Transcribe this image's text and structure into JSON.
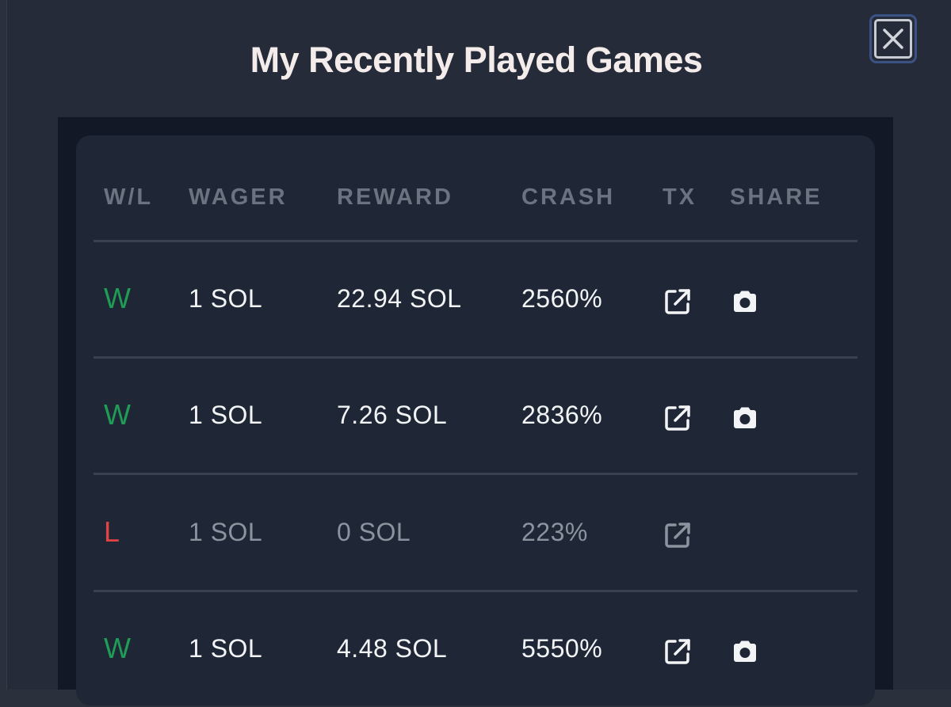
{
  "modal": {
    "title": "My Recently Played Games",
    "close_label": "Close"
  },
  "table": {
    "headers": {
      "wl": "W/L",
      "wager": "WAGER",
      "reward": "REWARD",
      "crash": "CRASH",
      "tx": "TX",
      "share": "SHARE"
    },
    "rows": [
      {
        "result": "W",
        "wager": "1 SOL",
        "reward": "22.94 SOL",
        "crash": "2560%",
        "tx_icon": "external-link-icon",
        "share_icon": "camera-icon"
      },
      {
        "result": "W",
        "wager": "1 SOL",
        "reward": "7.26 SOL",
        "crash": "2836%",
        "tx_icon": "external-link-icon",
        "share_icon": "camera-icon"
      },
      {
        "result": "L",
        "wager": "1 SOL",
        "reward": "0 SOL",
        "crash": "223%",
        "tx_icon": "external-link-icon",
        "share_icon": ""
      },
      {
        "result": "W",
        "wager": "1 SOL",
        "reward": "4.48 SOL",
        "crash": "5550%",
        "tx_icon": "external-link-icon",
        "share_icon": "camera-icon"
      }
    ]
  },
  "colors": {
    "win": "#1f9d55",
    "loss": "#e04343",
    "background": "#252b38",
    "card": "#1f2736",
    "accent_border": "#3b5384"
  }
}
